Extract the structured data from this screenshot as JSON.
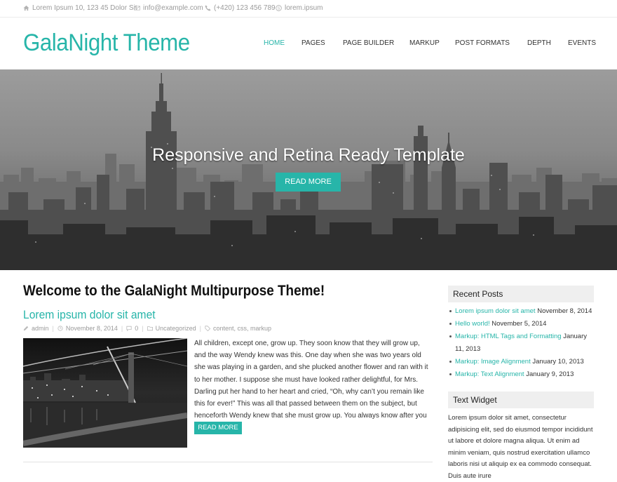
{
  "topbar": {
    "address": "Lorem Ipsum 10, 123 45 Dolor Sit",
    "email": "info@example.com",
    "phone": "(+420) 123 456 789",
    "skype": "lorem.ipsum",
    "icons": [
      "home-icon",
      "envelope-icon",
      "phone-icon",
      "skype-icon"
    ]
  },
  "header": {
    "site_title": "GalaNight Theme",
    "nav": [
      "HOME",
      "PAGES",
      "PAGE BUILDER",
      "MARKUP",
      "POST FORMATS",
      "DEPTH",
      "EVENTS"
    ],
    "active_nav": "HOME"
  },
  "hero": {
    "title": "Responsive and Retina Ready Template",
    "button": "READ MORE"
  },
  "main": {
    "page_title": "Welcome to the GalaNight Multipurpose Theme!",
    "post": {
      "title": "Lorem ipsum dolor sit amet",
      "author": "admin",
      "date": "November 8, 2014",
      "comments": "0",
      "category": "Uncategorized",
      "tags": "content, css, markup",
      "excerpt": "All children, except one, grow up. They soon know that they will grow up, and the way Wendy knew was this. One day when she was two years old she was playing in a garden, and she plucked another flower and ran with it to her mother. I suppose she must have looked rather delightful, for Mrs. Darling put her hand to her heart and cried, “Oh, why can’t you remain like this for ever!” This was all that passed between them on the subject, but henceforth Wendy knew that she must grow up. You always know after you are…",
      "read_more": "READ MORE"
    }
  },
  "sidebar": {
    "recent_title": "Recent Posts",
    "recent_posts": [
      {
        "title": "Lorem ipsum dolor sit amet",
        "date": "November 8, 2014"
      },
      {
        "title": "Hello world!",
        "date": "November 5, 2014"
      },
      {
        "title": "Markup: HTML Tags and Formatting",
        "date": "January 11, 2013"
      },
      {
        "title": "Markup: Image Alignment",
        "date": "January 10, 2013"
      },
      {
        "title": "Markup: Text Alignment",
        "date": "January 9, 2013"
      }
    ],
    "text_widget_title": "Text Widget",
    "text_widget_body": "Lorem ipsum dolor sit amet, consectetur adipisicing elit, sed do eiusmod tempor incididunt ut labore et dolore magna aliqua. Ut enim ad minim veniam, quis nostrud exercitation ullamco laboris nisi ut aliquip ex ea commodo consequat. Duis aute irure"
  },
  "colors": {
    "accent": "#27b5a9",
    "text": "#333333",
    "widget_bg": "#efefef"
  }
}
